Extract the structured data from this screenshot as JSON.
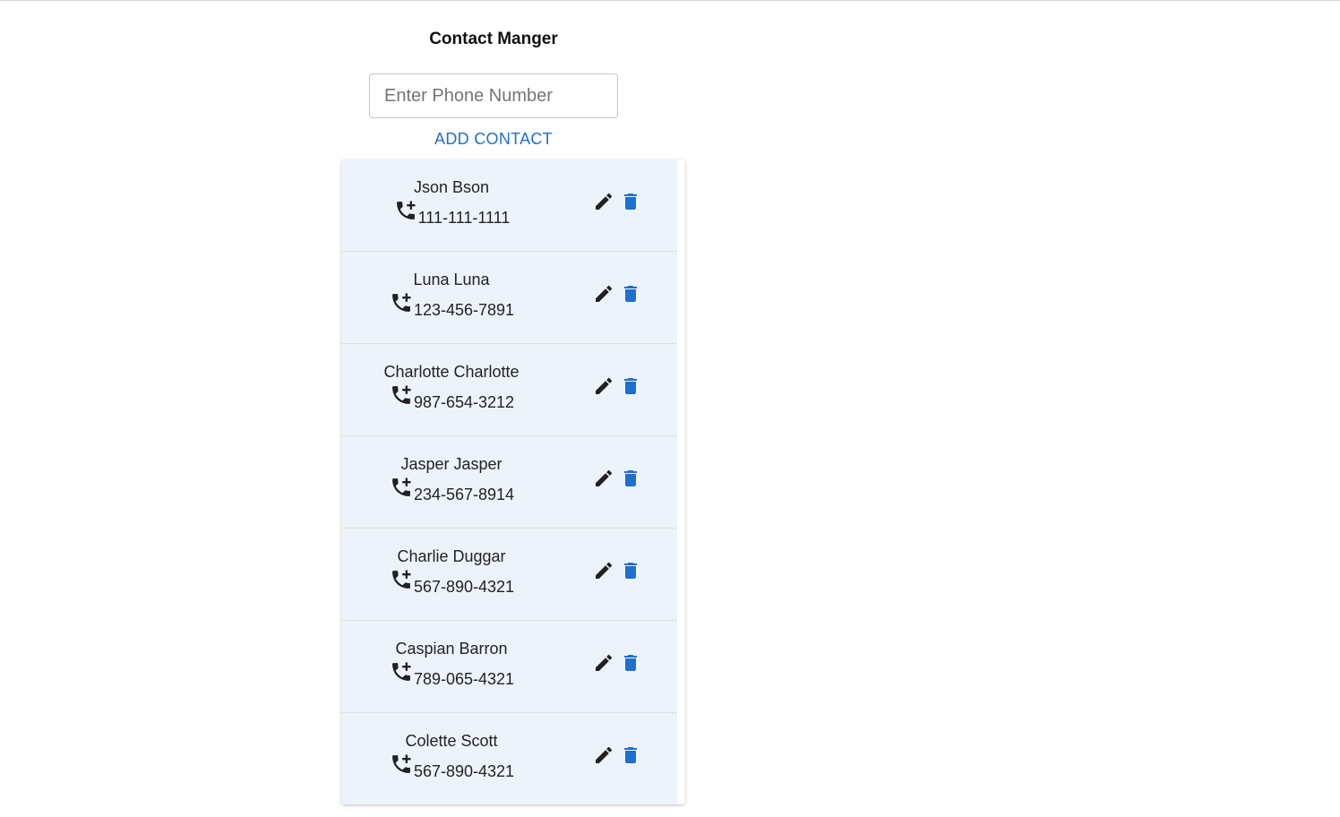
{
  "app": {
    "title": "Contact Manger"
  },
  "form": {
    "phone_placeholder": "Enter Phone Number",
    "phone_value": "",
    "add_label": "ADD CONTACT"
  },
  "colors": {
    "accent": "#1e6fd0",
    "row_background": "#edf3fa",
    "edit_icon": "#212121",
    "delete_icon": "#1e6fd0"
  },
  "icons": {
    "phone": "add-call-icon",
    "edit": "pencil-icon",
    "delete": "trash-icon"
  },
  "contacts": [
    {
      "name": "Json Bson",
      "phone": "111-111-1111"
    },
    {
      "name": "Luna Luna",
      "phone": "123-456-7891"
    },
    {
      "name": "Charlotte Charlotte",
      "phone": "987-654-3212"
    },
    {
      "name": "Jasper Jasper",
      "phone": "234-567-8914"
    },
    {
      "name": "Charlie Duggar",
      "phone": "567-890-4321"
    },
    {
      "name": "Caspian Barron",
      "phone": "789-065-4321"
    },
    {
      "name": "Colette Scott",
      "phone": "567-890-4321"
    }
  ]
}
